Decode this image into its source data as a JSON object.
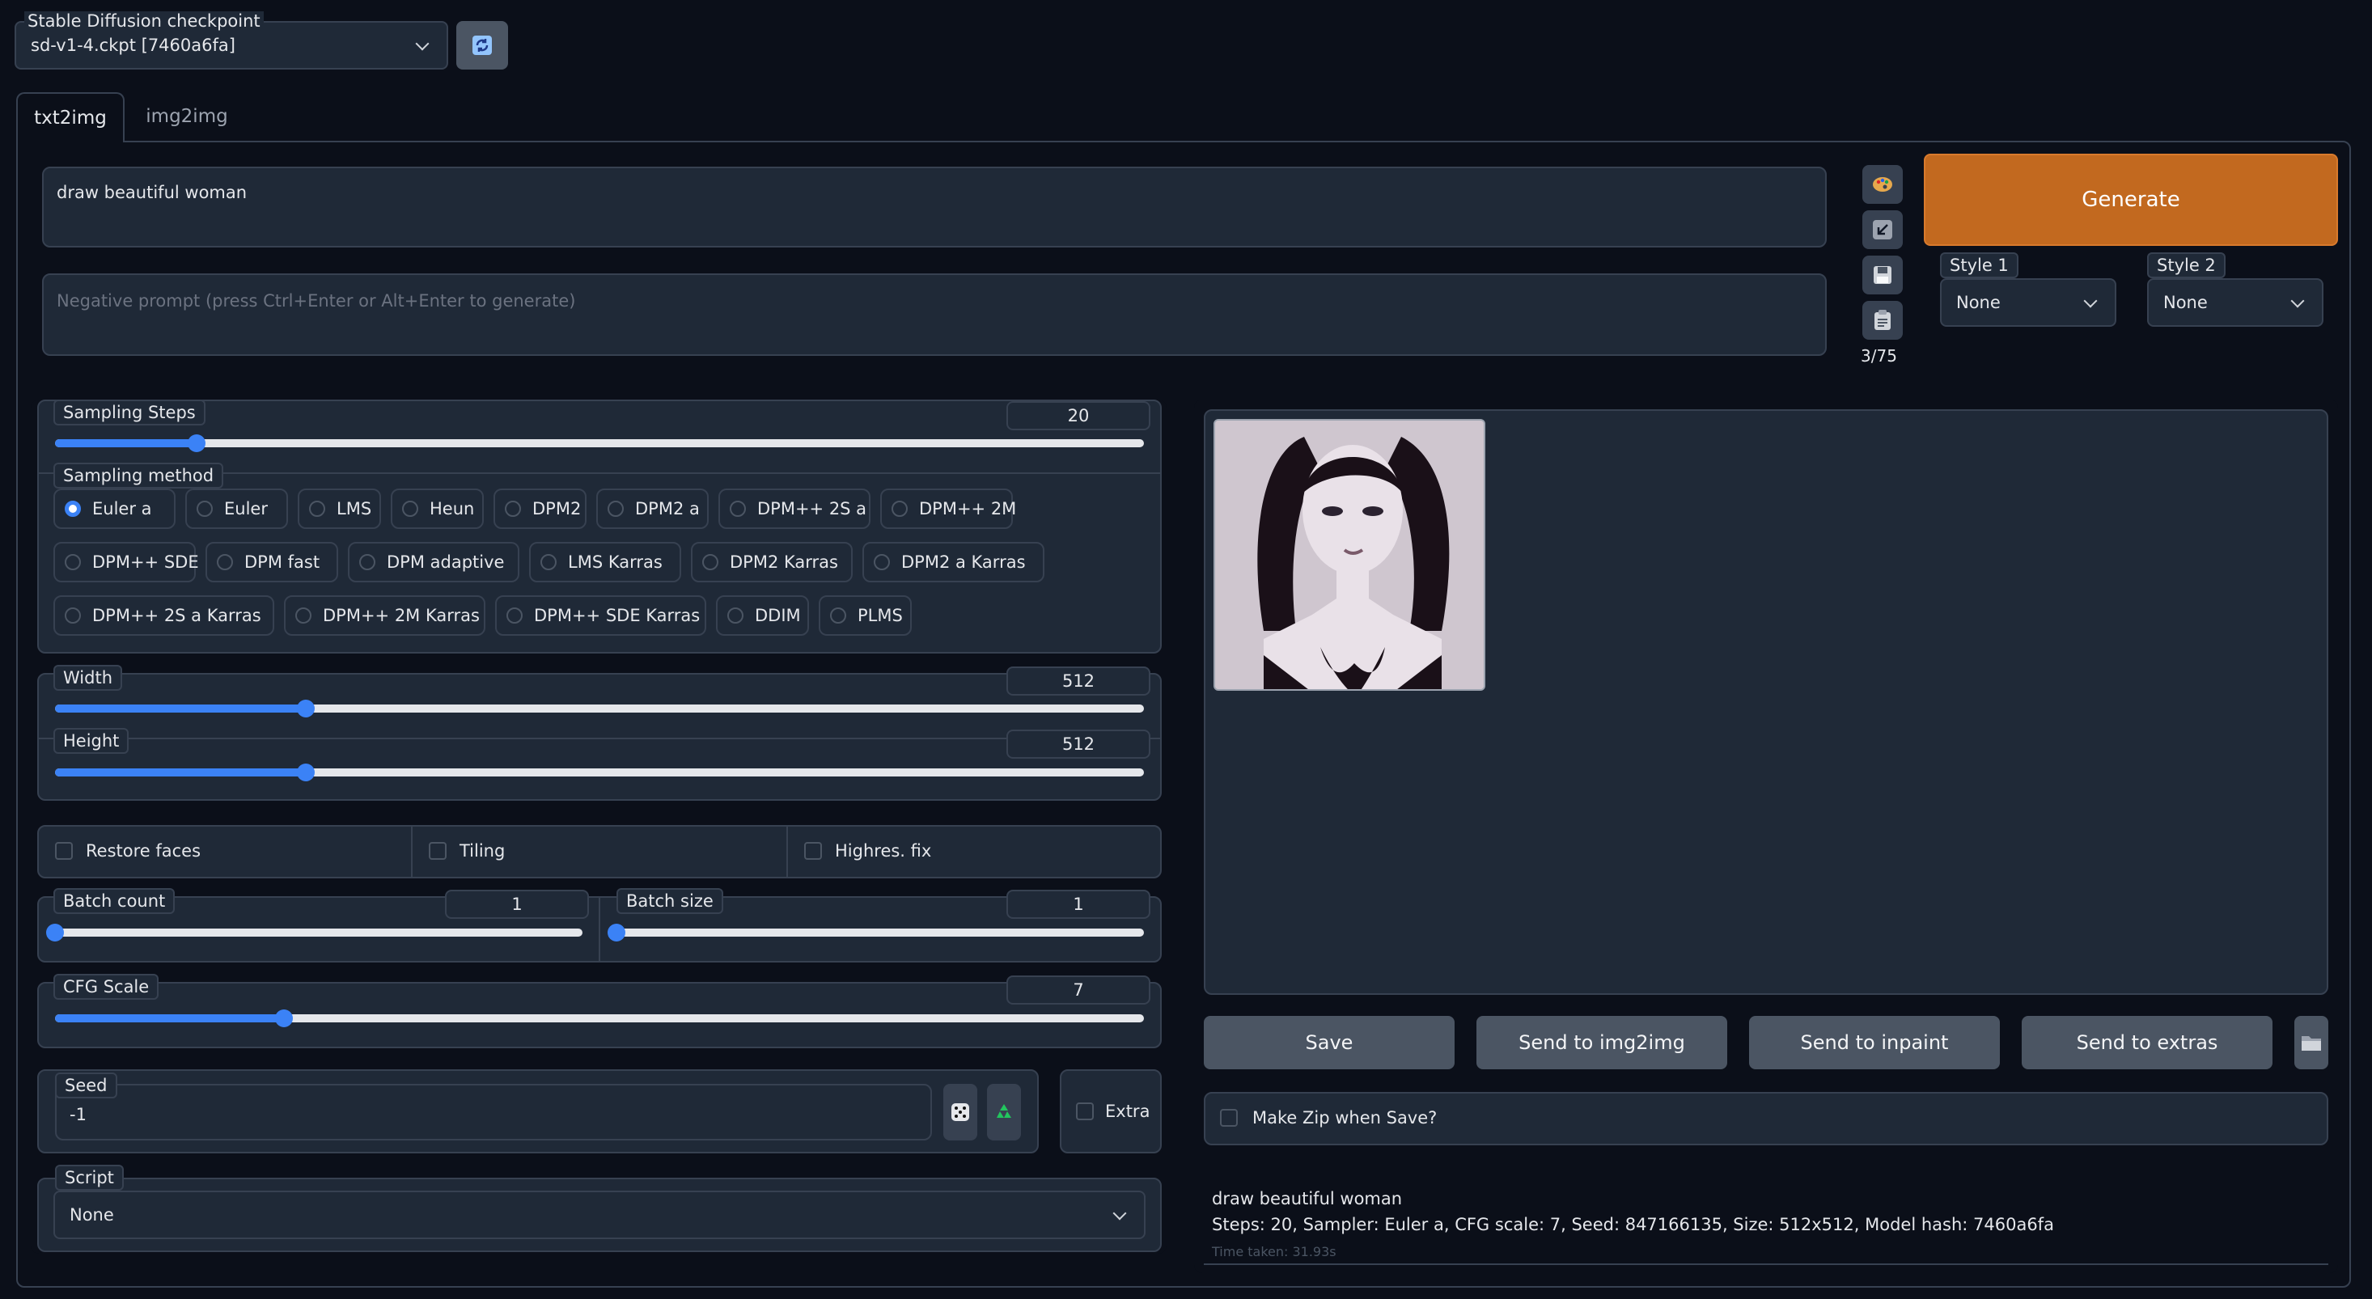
{
  "checkpoint": {
    "label": "Stable Diffusion checkpoint",
    "value": "sd-v1-4.ckpt [7460a6fa]",
    "refresh_icon": "refresh-icon"
  },
  "tabs": [
    {
      "label": "txt2img",
      "active": true
    },
    {
      "label": "img2img",
      "active": false
    }
  ],
  "prompt": {
    "value": "draw beautiful woman",
    "negative_placeholder": "Negative prompt (press Ctrl+Enter or Alt+Enter to generate)",
    "token_count": "3/75"
  },
  "tool_icons": [
    "palette-icon",
    "arrow-down-left-icon",
    "save-disk-icon",
    "clipboard-icon"
  ],
  "generate": {
    "label": "Generate",
    "color": "#c2691f"
  },
  "styles": [
    {
      "label": "Style 1",
      "value": "None"
    },
    {
      "label": "Style 2",
      "value": "None"
    }
  ],
  "sampling_steps": {
    "label": "Sampling Steps",
    "value": "20",
    "fraction": 0.13
  },
  "sampling_method": {
    "label": "Sampling method",
    "selected": "Euler a",
    "rows": [
      [
        "Euler a",
        "Euler",
        "LMS",
        "Heun",
        "DPM2",
        "DPM2 a",
        "DPM++ 2S a",
        "DPM++ 2M"
      ],
      [
        "DPM++ SDE",
        "DPM fast",
        "DPM adaptive",
        "LMS Karras",
        "DPM2 Karras",
        "DPM2 a Karras"
      ],
      [
        "DPM++ 2S a Karras",
        "DPM++ 2M Karras",
        "DPM++ SDE Karras",
        "DDIM",
        "PLMS"
      ]
    ]
  },
  "width": {
    "label": "Width",
    "value": "512",
    "fraction": 0.23
  },
  "height": {
    "label": "Height",
    "value": "512",
    "fraction": 0.23
  },
  "checks": {
    "restore_faces": "Restore faces",
    "tiling": "Tiling",
    "highres": "Highres. fix"
  },
  "batch_count": {
    "label": "Batch count",
    "value": "1",
    "fraction": 0.0
  },
  "batch_size": {
    "label": "Batch size",
    "value": "1",
    "fraction": 0.0
  },
  "cfg_scale": {
    "label": "CFG Scale",
    "value": "7",
    "fraction": 0.21
  },
  "seed": {
    "label": "Seed",
    "value": "-1",
    "extra_label": "Extra",
    "dice_icon": "dice-icon",
    "recycle_icon": "recycle-icon"
  },
  "script": {
    "label": "Script",
    "value": "None"
  },
  "output": {
    "buttons": {
      "save": "Save",
      "img2img": "Send to img2img",
      "inpaint": "Send to inpaint",
      "extras": "Send to extras"
    },
    "folder_icon": "folder-icon",
    "make_zip": "Make Zip when Save?",
    "info_prompt": "draw beautiful woman",
    "info_params": "Steps: 20, Sampler: Euler a, CFG scale: 7, Seed: 847166135, Size: 512x512, Model hash: 7460a6fa",
    "time_taken": "Time taken: 31.93s"
  }
}
